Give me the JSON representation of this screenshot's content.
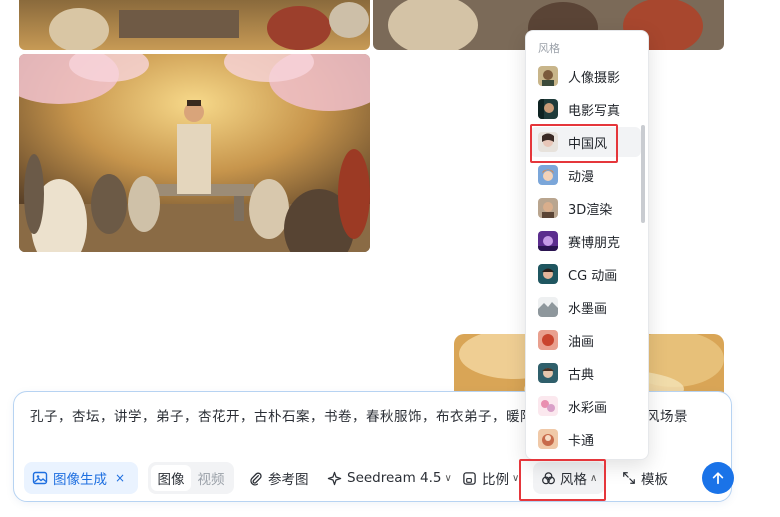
{
  "prompt": {
    "text": "孔子，杏坛，讲学，弟子，杏花开，古朴石案，书卷，春秋服饰，布衣弟子，暖阳光，柔和光影，古风场景"
  },
  "toolbar": {
    "generate_chip_label": "图像生成",
    "generate_chip_remove": "×",
    "mode_image": "图像",
    "mode_video": "视频",
    "reference_label": "参考图",
    "model_label": "Seedream 4.5",
    "ratio_label": "比例",
    "style_label": "风格",
    "template_label": "模板"
  },
  "style_menu": {
    "title": "风格",
    "selected": "中国风",
    "items": [
      {
        "label": "人像摄影"
      },
      {
        "label": "电影写真"
      },
      {
        "label": "中国风"
      },
      {
        "label": "动漫"
      },
      {
        "label": "3D渲染"
      },
      {
        "label": "赛博朋克"
      },
      {
        "label": "CG 动画"
      },
      {
        "label": "水墨画"
      },
      {
        "label": "油画"
      },
      {
        "label": "古典"
      },
      {
        "label": "水彩画"
      },
      {
        "label": "卡通"
      }
    ]
  },
  "colors": {
    "accent": "#1a73e8",
    "highlight_box": "#e5363b",
    "chip_bg": "#eaf3ff"
  }
}
